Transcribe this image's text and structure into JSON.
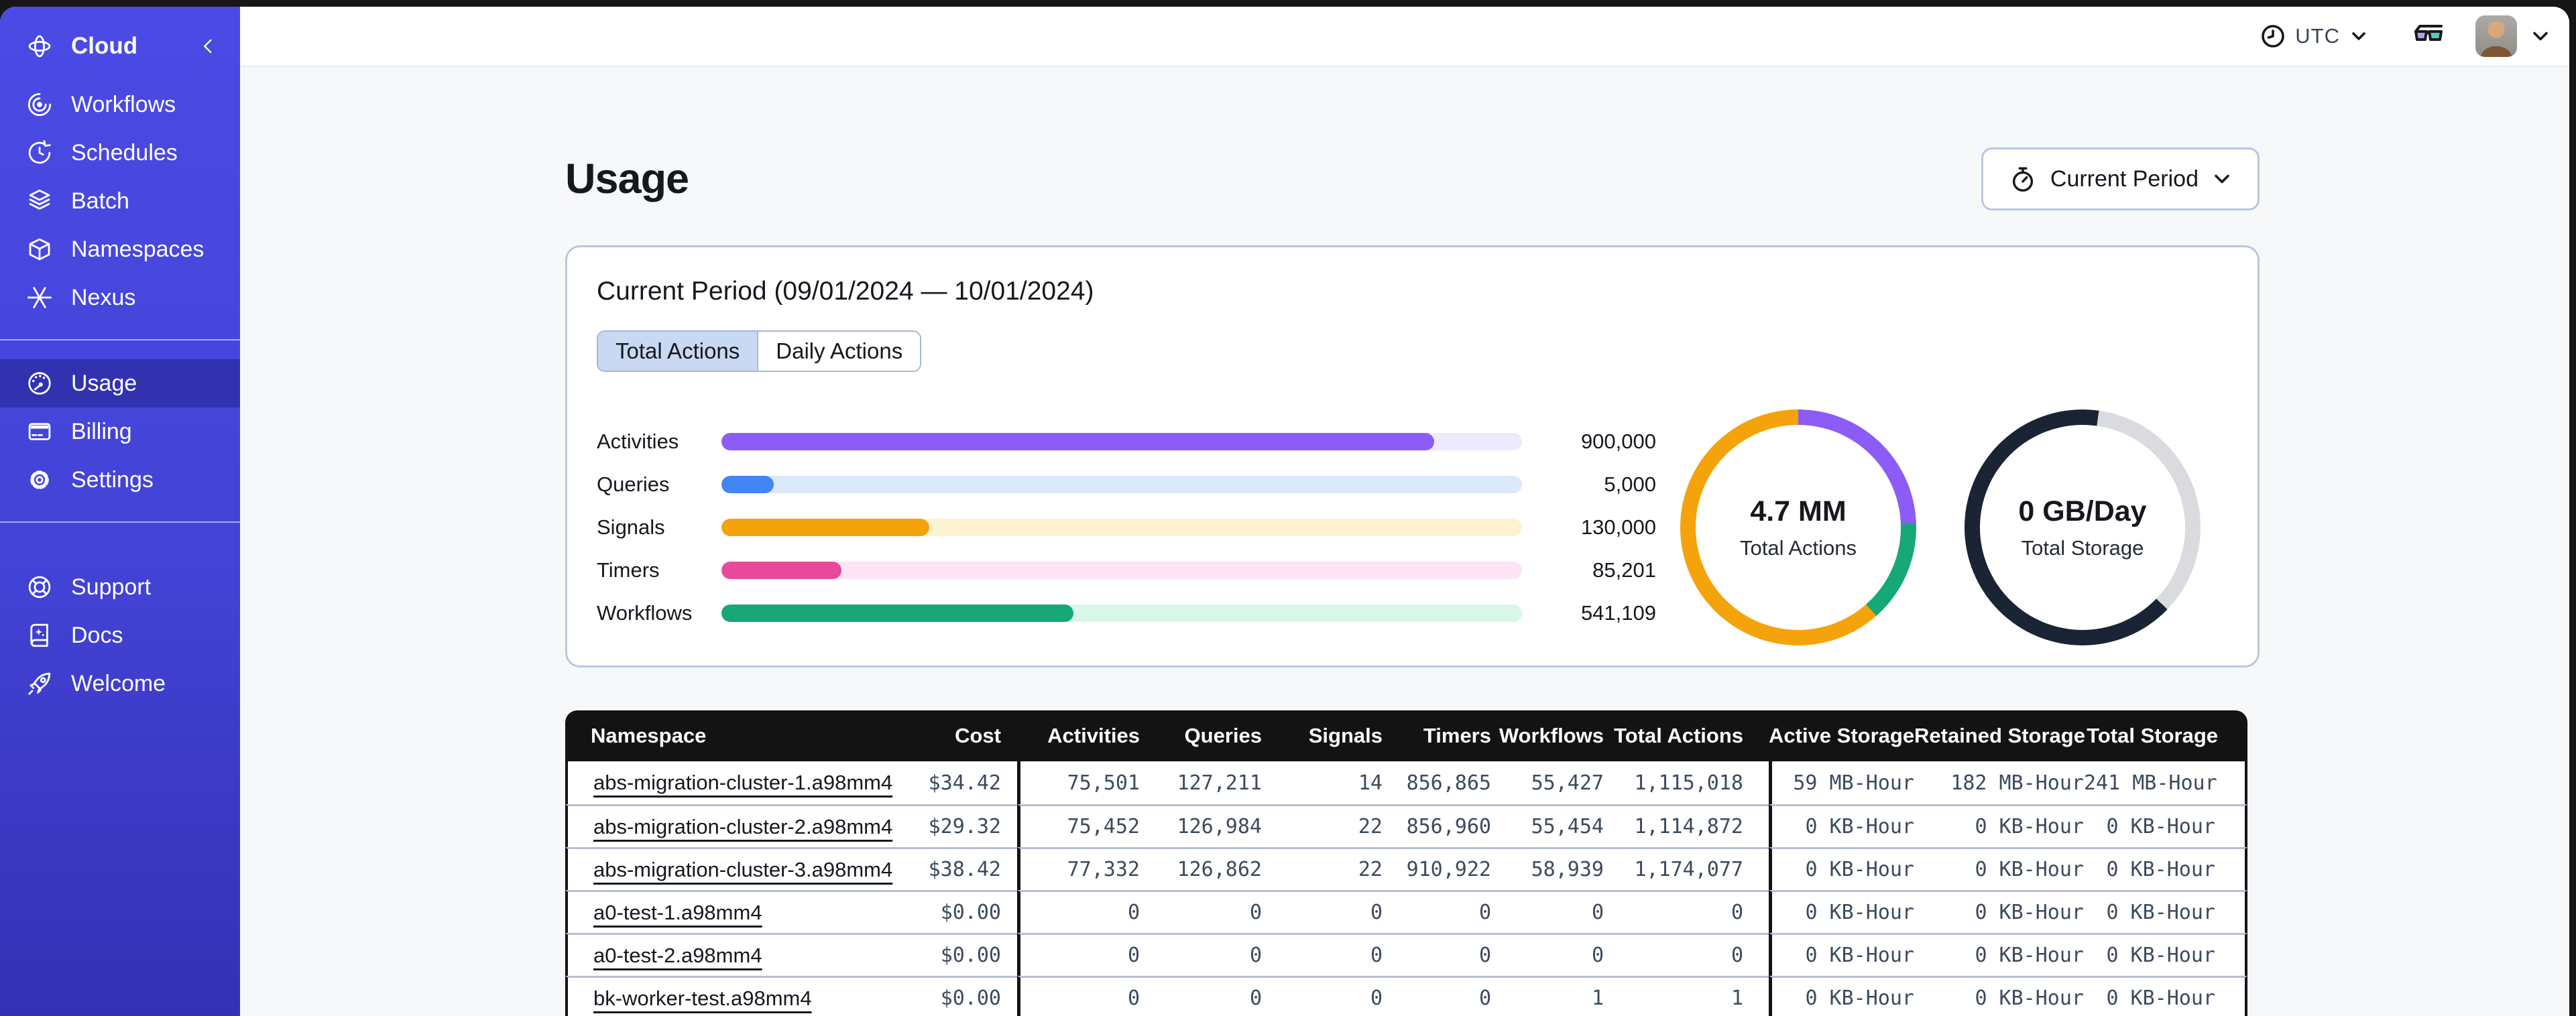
{
  "appearance": {
    "sidebar_top": "#4B4AE5",
    "sidebar_bottom": "#3431B5",
    "page_bg": "#F7F8FA",
    "card_border": "#BAC6E2",
    "table_header_bg": "#131313",
    "selected_tab_bg": "#C9D8F3"
  },
  "sidebar": {
    "brand": {
      "label": "Cloud",
      "icon": "temporal-logo-icon"
    },
    "nav": [
      {
        "label": "Workflows",
        "icon": "workflows-icon"
      },
      {
        "label": "Schedules",
        "icon": "schedules-icon"
      },
      {
        "label": "Batch",
        "icon": "batch-icon"
      },
      {
        "label": "Namespaces",
        "icon": "namespaces-icon"
      },
      {
        "label": "Nexus",
        "icon": "nexus-icon"
      }
    ],
    "account": [
      {
        "label": "Usage",
        "icon": "usage-gauge-icon",
        "selected": true
      },
      {
        "label": "Billing",
        "icon": "billing-card-icon",
        "selected": false
      },
      {
        "label": "Settings",
        "icon": "settings-gear-icon",
        "selected": false
      }
    ],
    "resources": [
      {
        "label": "Support",
        "icon": "support-lifebuoy-icon"
      },
      {
        "label": "Docs",
        "icon": "docs-book-icon"
      },
      {
        "label": "Welcome",
        "icon": "welcome-rocket-icon"
      }
    ]
  },
  "topbar": {
    "timezone": "UTC"
  },
  "main": {
    "title": "Usage",
    "period_button": {
      "label": "Current Period",
      "icon": "stopwatch-icon"
    },
    "card_title": "Current Period (09/01/2024 — 10/01/2024)",
    "tabs": [
      {
        "label": "Total Actions",
        "selected": true
      },
      {
        "label": "Daily Actions",
        "selected": false
      }
    ]
  },
  "chart_data": [
    {
      "type": "bar",
      "title": "Current period totals by type",
      "categories": [
        "Activities",
        "Queries",
        "Signals",
        "Timers",
        "Workflows"
      ],
      "values": [
        900000,
        5000,
        130000,
        85201,
        541109
      ],
      "value_labels": [
        "900,000",
        "5,000",
        "130,000",
        "85,201",
        "541,109"
      ],
      "fill_pct": [
        89,
        6.5,
        26,
        15,
        44
      ],
      "colors": [
        "#8B5CF6",
        "#4285F5",
        "#F5A30B",
        "#E8499A",
        "#16A877"
      ],
      "track_colors": [
        "#EEE9FC",
        "#DCE9FC",
        "#FDF3CE",
        "#FCE4F4",
        "#D9F7E9"
      ]
    },
    {
      "type": "pie",
      "center_value": "4.7 MM",
      "center_label": "Total Actions",
      "rotate": 0,
      "segments": [
        {
          "name": "activities",
          "color": "#8B5CF6",
          "pct": 24.5
        },
        {
          "name": "workflows",
          "color": "#16A877",
          "pct": 14
        },
        {
          "name": "signals",
          "color": "#F5A30B",
          "pct": 61.5
        }
      ]
    },
    {
      "type": "pie",
      "center_value": "0 GB/Day",
      "center_label": "Total Storage",
      "rotate": 8,
      "segments": [
        {
          "name": "retained",
          "color": "#D9DBDF",
          "pct": 35
        },
        {
          "name": "active",
          "color": "#1B2434",
          "pct": 65
        }
      ]
    }
  ],
  "table": {
    "columns": [
      "Namespace",
      "Cost",
      "Activities",
      "Queries",
      "Signals",
      "Timers",
      "Workflows",
      "Total Actions",
      "Active Storage",
      "Retained Storage",
      "Total Storage"
    ],
    "rows": [
      {
        "namespace": "abs-migration-cluster-1.a98mm4",
        "cost": "$34.42",
        "activities": "75,501",
        "queries": "127,211",
        "signals": "14",
        "timers": "856,865",
        "workflows": "55,427",
        "total_actions": "1,115,018",
        "active_storage": "59 MB-Hour",
        "retained_storage": "182 MB-Hour",
        "total_storage": "241 MB-Hour"
      },
      {
        "namespace": "abs-migration-cluster-2.a98mm4",
        "cost": "$29.32",
        "activities": "75,452",
        "queries": "126,984",
        "signals": "22",
        "timers": "856,960",
        "workflows": "55,454",
        "total_actions": "1,114,872",
        "active_storage": "0 KB-Hour",
        "retained_storage": "0 KB-Hour",
        "total_storage": "0 KB-Hour"
      },
      {
        "namespace": "abs-migration-cluster-3.a98mm4",
        "cost": "$38.42",
        "activities": "77,332",
        "queries": "126,862",
        "signals": "22",
        "timers": "910,922",
        "workflows": "58,939",
        "total_actions": "1,174,077",
        "active_storage": "0 KB-Hour",
        "retained_storage": "0 KB-Hour",
        "total_storage": "0 KB-Hour"
      },
      {
        "namespace": "a0-test-1.a98mm4",
        "cost": "$0.00",
        "activities": "0",
        "queries": "0",
        "signals": "0",
        "timers": "0",
        "workflows": "0",
        "total_actions": "0",
        "active_storage": "0 KB-Hour",
        "retained_storage": "0 KB-Hour",
        "total_storage": "0 KB-Hour"
      },
      {
        "namespace": "a0-test-2.a98mm4",
        "cost": "$0.00",
        "activities": "0",
        "queries": "0",
        "signals": "0",
        "timers": "0",
        "workflows": "0",
        "total_actions": "0",
        "active_storage": "0 KB-Hour",
        "retained_storage": "0 KB-Hour",
        "total_storage": "0 KB-Hour"
      },
      {
        "namespace": "bk-worker-test.a98mm4",
        "cost": "$0.00",
        "activities": "0",
        "queries": "0",
        "signals": "0",
        "timers": "0",
        "workflows": "1",
        "total_actions": "1",
        "active_storage": "0 KB-Hour",
        "retained_storage": "0 KB-Hour",
        "total_storage": "0 KB-Hour"
      }
    ]
  }
}
